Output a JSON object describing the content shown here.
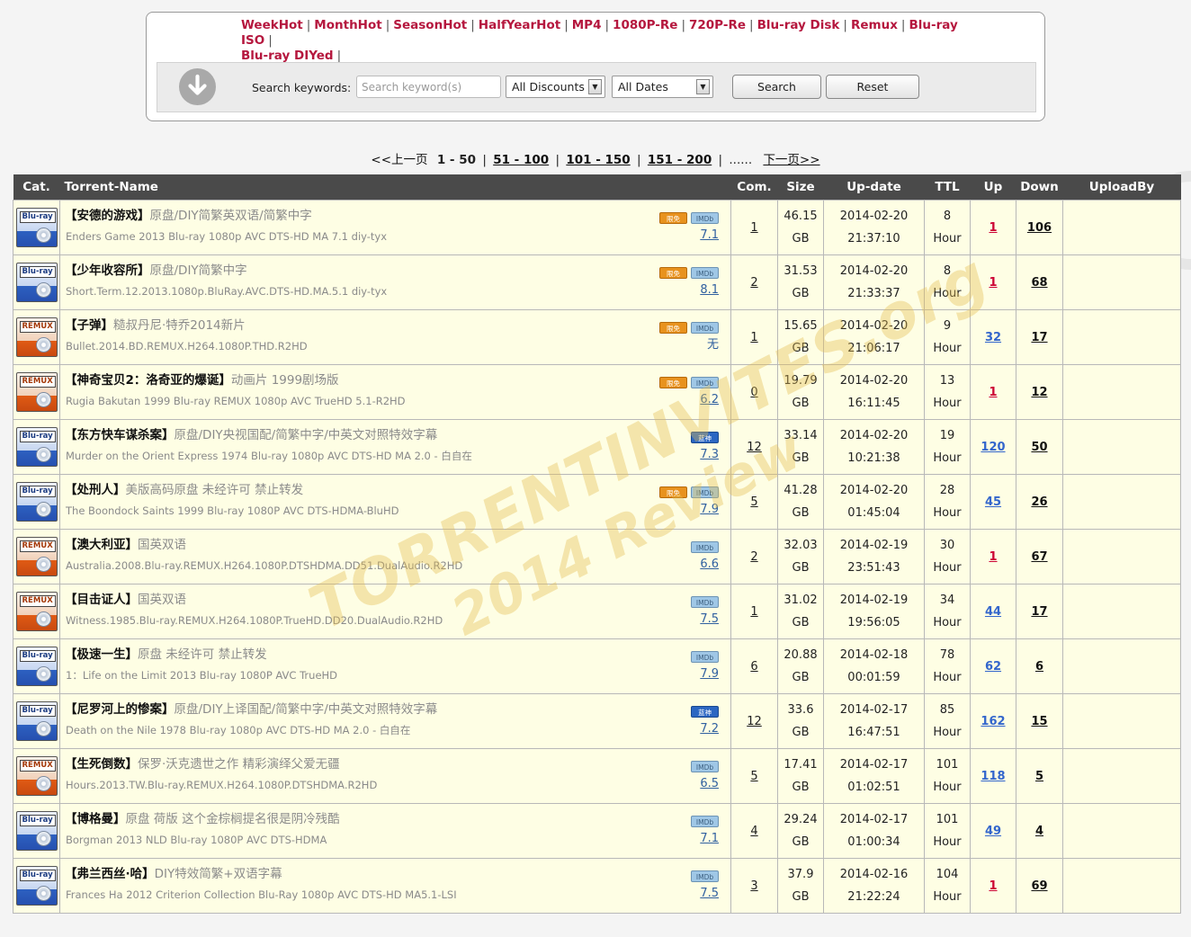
{
  "hot_links": [
    "WeekHot",
    "MonthHot",
    "SeasonHot",
    "HalfYearHot",
    "MP4",
    "1080P-Re",
    "720P-Re",
    "Blu-ray Disk",
    "Remux",
    "Blu-ray ISO",
    "Blu-ray DIYed"
  ],
  "search": {
    "label": "Search keywords:",
    "placeholder": "Search keyword(s)",
    "discount_select": "All Discounts",
    "date_select": "All Dates",
    "search_button": "Search",
    "reset_button": "Reset"
  },
  "pager": {
    "prev": "<<上一页",
    "current": "1 - 50",
    "pages": [
      "51 - 100",
      "101 - 150",
      "151 - 200"
    ],
    "ellipsis": "......",
    "next": "下一页>>"
  },
  "table": {
    "headers": {
      "cat": "Cat.",
      "name": "Torrent-Name",
      "com": "Com.",
      "size": "Size",
      "update": "Up-date",
      "ttl": "TTL",
      "up": "Up",
      "down": "Down",
      "uploadby": "UploadBy"
    },
    "rows": [
      {
        "cat": "Blu-ray",
        "title": "【安德的游戏】",
        "desc": "原盘/DIY简繁英双语/简繁中字",
        "en": "Enders Game 2013 Blu-ray 1080p AVC DTS-HD MA 7.1 diy-tyx",
        "free": "限免",
        "imdb": "IMDb",
        "rating": "7.1",
        "com": "1",
        "size": "46.15",
        "unit": "GB",
        "date": "2014-02-20",
        "time": "21:37:10",
        "ttl": "8",
        "ttl_unit": "Hour",
        "up": "1",
        "down": "106"
      },
      {
        "cat": "Blu-ray",
        "title": "【少年收容所】",
        "desc": "原盘/DIY简繁中字",
        "en": "Short.Term.12.2013.1080p.BluRay.AVC.DTS-HD.MA.5.1 diy-tyx",
        "free": "限免",
        "imdb": "IMDb",
        "rating": "8.1",
        "com": "2",
        "size": "31.53",
        "unit": "GB",
        "date": "2014-02-20",
        "time": "21:33:37",
        "ttl": "8",
        "ttl_unit": "Hour",
        "up": "1",
        "down": "68"
      },
      {
        "cat": "REMUX",
        "title": "【子弹】",
        "desc": "糙叔丹尼·特乔2014新片",
        "en": "Bullet.2014.BD.REMUX.H264.1080P.THD.R2HD",
        "free": "限免",
        "imdb": "IMDb",
        "rating": "无",
        "com": "1",
        "size": "15.65",
        "unit": "GB",
        "date": "2014-02-20",
        "time": "21:06:17",
        "ttl": "9",
        "ttl_unit": "Hour",
        "up": "32",
        "down": "17"
      },
      {
        "cat": "REMUX",
        "title": "【神奇宝贝2：洛奇亚的爆诞】",
        "desc": "动画片 1999剧场版",
        "en": "Rugia Bakutan 1999 Blu-ray REMUX 1080p AVC TrueHD 5.1-R2HD",
        "free": "限免",
        "imdb": "IMDb",
        "rating": "6.2",
        "com": "0",
        "size": "19.79",
        "unit": "GB",
        "date": "2014-02-20",
        "time": "16:11:45",
        "ttl": "13",
        "ttl_unit": "Hour",
        "up": "1",
        "down": "12"
      },
      {
        "cat": "Blu-ray",
        "title": "【东方快车谋杀案】",
        "desc": "原盘/DIY央视国配/简繁中字/中英文对照特效字幕",
        "en": "Murder on the Orient Express 1974 Blu-ray 1080p AVC DTS-HD MA 2.0 - 白自在",
        "free": "",
        "imdb": "蓝神",
        "rating": "7.3",
        "com": "12",
        "size": "33.14",
        "unit": "GB",
        "date": "2014-02-20",
        "time": "10:21:38",
        "ttl": "19",
        "ttl_unit": "Hour",
        "up": "120",
        "down": "50"
      },
      {
        "cat": "Blu-ray",
        "title": "【处刑人】",
        "desc": "美版高码原盘 未经许可 禁止转发",
        "en": "The Boondock Saints 1999 Blu-ray 1080P AVC DTS-HDMA-BluHD",
        "free": "限免",
        "imdb": "IMDb",
        "rating": "7.9",
        "com": "5",
        "size": "41.28",
        "unit": "GB",
        "date": "2014-02-20",
        "time": "01:45:04",
        "ttl": "28",
        "ttl_unit": "Hour",
        "up": "45",
        "down": "26"
      },
      {
        "cat": "REMUX",
        "title": "【澳大利亚】",
        "desc": "国英双语",
        "en": "Australia.2008.Blu-ray.REMUX.H264.1080P.DTSHDMA.DD51.DualAudio.R2HD",
        "free": "",
        "imdb": "IMDb",
        "rating": "6.6",
        "com": "2",
        "size": "32.03",
        "unit": "GB",
        "date": "2014-02-19",
        "time": "23:51:43",
        "ttl": "30",
        "ttl_unit": "Hour",
        "up": "1",
        "down": "67"
      },
      {
        "cat": "REMUX",
        "title": "【目击证人】",
        "desc": "国英双语",
        "en": "Witness.1985.Blu-ray.REMUX.H264.1080P.TrueHD.DD20.DualAudio.R2HD",
        "free": "",
        "imdb": "IMDb",
        "rating": "7.5",
        "com": "1",
        "size": "31.02",
        "unit": "GB",
        "date": "2014-02-19",
        "time": "19:56:05",
        "ttl": "34",
        "ttl_unit": "Hour",
        "up": "44",
        "down": "17"
      },
      {
        "cat": "Blu-ray",
        "title": "【极速一生】",
        "desc": "原盘 未经许可 禁止转发",
        "en": "1：Life on the Limit 2013 Blu-ray 1080P AVC TrueHD",
        "free": "",
        "imdb": "IMDb",
        "rating": "7.9",
        "com": "6",
        "size": "20.88",
        "unit": "GB",
        "date": "2014-02-18",
        "time": "00:01:59",
        "ttl": "78",
        "ttl_unit": "Hour",
        "up": "62",
        "down": "6"
      },
      {
        "cat": "Blu-ray",
        "title": "【尼罗河上的惨案】",
        "desc": "原盘/DIY上译国配/简繁中字/中英文对照特效字幕",
        "en": "Death on the Nile 1978 Blu-ray 1080p AVC DTS-HD MA 2.0 - 白自在",
        "free": "",
        "imdb": "蓝神",
        "rating": "7.2",
        "com": "12",
        "size": "33.6",
        "unit": "GB",
        "date": "2014-02-17",
        "time": "16:47:51",
        "ttl": "85",
        "ttl_unit": "Hour",
        "up": "162",
        "down": "15"
      },
      {
        "cat": "REMUX",
        "title": "【生死倒数】",
        "desc": "保罗·沃克遗世之作 精彩演绎父爱无疆",
        "en": "Hours.2013.TW.Blu-ray.REMUX.H264.1080P.DTSHDMA.R2HD",
        "free": "",
        "imdb": "IMDb",
        "rating": "6.5",
        "com": "5",
        "size": "17.41",
        "unit": "GB",
        "date": "2014-02-17",
        "time": "01:02:51",
        "ttl": "101",
        "ttl_unit": "Hour",
        "up": "118",
        "down": "5"
      },
      {
        "cat": "Blu-ray",
        "title": "【博格曼】",
        "desc": "原盘 荷版 这个金棕榈提名很是阴冷残酷",
        "en": "Borgman 2013 NLD Blu-ray 1080P AVC DTS-HDMA",
        "free": "",
        "imdb": "IMDb",
        "rating": "7.1",
        "com": "4",
        "size": "29.24",
        "unit": "GB",
        "date": "2014-02-17",
        "time": "01:00:34",
        "ttl": "101",
        "ttl_unit": "Hour",
        "up": "49",
        "down": "4"
      },
      {
        "cat": "Blu-ray",
        "title": "【弗兰西丝·哈】",
        "desc": "DIY特效简繁+双语字幕",
        "en": "Frances Ha 2012 Criterion Collection Blu-Ray 1080p AVC DTS-HD MA5.1-LSI",
        "free": "",
        "imdb": "IMDb",
        "rating": "7.5",
        "com": "3",
        "size": "37.9",
        "unit": "GB",
        "date": "2014-02-16",
        "time": "21:22:24",
        "ttl": "104",
        "ttl_unit": "Hour",
        "up": "1",
        "down": "69"
      }
    ]
  },
  "watermark": {
    "line1": "TORRENTINVITES.org",
    "line2": "2014 Review"
  },
  "icons": {
    "download": "download-arrow-icon",
    "select_arrow": "dropdown-arrow-icon",
    "category": "disc-category-icon"
  },
  "colors": {
    "hot_link": "#b5173e",
    "header_bg": "#4a4a4a",
    "row_bg": "#fefee4",
    "up_link": "#3366cc",
    "up_low": "#cc0033"
  }
}
